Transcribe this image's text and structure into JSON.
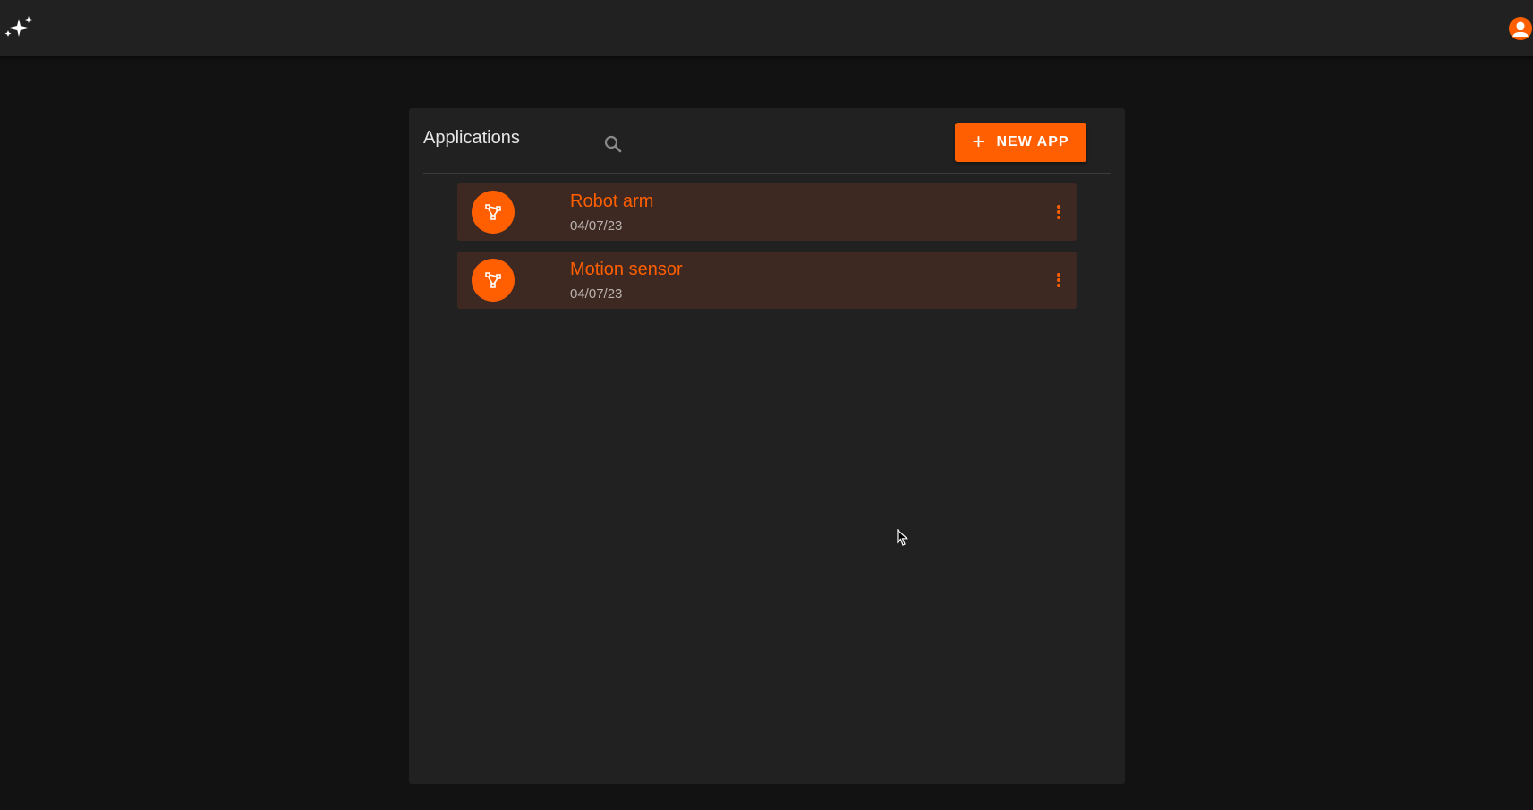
{
  "header": {
    "logo_icon": "sparkles-icon",
    "account_icon": "account-circle-icon"
  },
  "panel": {
    "title": "Applications",
    "search_icon": "search-icon",
    "new_app_label": "NEW APP",
    "new_app_icon": "plus-icon"
  },
  "apps": [
    {
      "name": "Robot arm",
      "date": "04/07/23",
      "icon": "graph-branch-icon",
      "menu_icon": "more-vert-icon"
    },
    {
      "name": "Motion sensor",
      "date": "04/07/23",
      "icon": "graph-branch-icon",
      "menu_icon": "more-vert-icon"
    }
  ],
  "colors": {
    "accent": "#ff5f00",
    "background": "#121212",
    "surface": "#212121",
    "row_background": "#3d2822"
  }
}
